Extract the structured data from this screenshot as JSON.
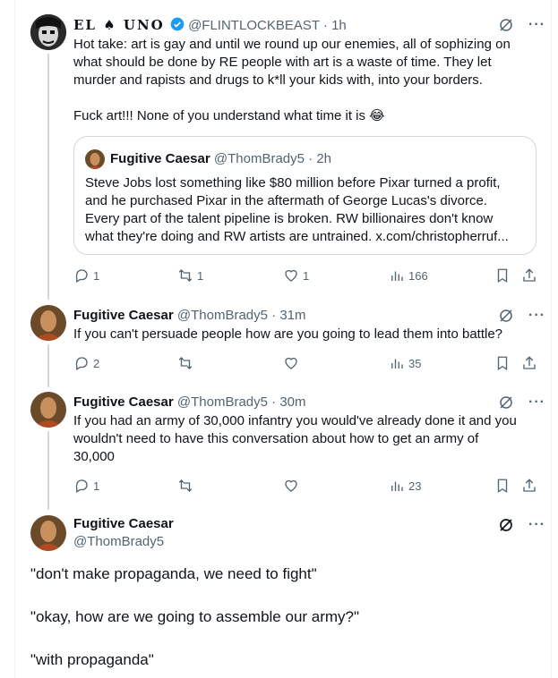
{
  "tweet1": {
    "name": "EL ♠ UNO",
    "handle": "@FLINTLOCKBEAST",
    "time": "· 1h",
    "text_lines": [
      "Hot take: art is gay and until we round up our enemies, all of sophizing on",
      "what should be done by RE people with art is a waste of time. They let",
      "murder and rapists and drugs to k*ll your kids with, into your borders.",
      "",
      "Fuck art!!! None of you understand what time it is 😂"
    ],
    "quote": {
      "name": "Fugitive Caesar",
      "handle": "@ThomBrady5",
      "time": "· 2h",
      "text_lines": [
        "Steve Jobs lost something like $80 million before Pixar turned a profit,",
        "and he purchased Pixar in the aftermath of George Lucas's divorce.",
        "Every part of the talent pipeline is broken. RW billionaires don't know",
        "what they're doing and RW artists are untrained. x.com/christopherruf..."
      ]
    },
    "replies": "1",
    "retweets": "1",
    "likes": "1",
    "views": "166"
  },
  "tweet2": {
    "name": "Fugitive Caesar",
    "handle": "@ThomBrady5",
    "time": "· 31m",
    "text_lines": [
      "If you can't persuade people how are you going to lead them into battle?"
    ],
    "replies": "2",
    "retweets": "",
    "likes": "",
    "views": "35"
  },
  "tweet3": {
    "name": "Fugitive Caesar",
    "handle": "@ThomBrady5",
    "time": "· 30m",
    "text_lines": [
      "If you had an army of 30,000 infantry you would've already done it and you",
      "wouldn't need to have this conversation about how to get an army of",
      "30,000"
    ],
    "replies": "1",
    "retweets": "",
    "likes": "",
    "views": "23"
  },
  "tweet4": {
    "name": "Fugitive Caesar",
    "handle": "@ThomBrady5",
    "paragraphs": [
      "\"don't make propaganda, we need to fight\"",
      "\"okay, how are we going to assemble our army?\"",
      "\"with propaganda\""
    ]
  },
  "colors": {
    "verified": "#1d9bf0",
    "secondary": "#536471",
    "line": "#cfd9de"
  }
}
